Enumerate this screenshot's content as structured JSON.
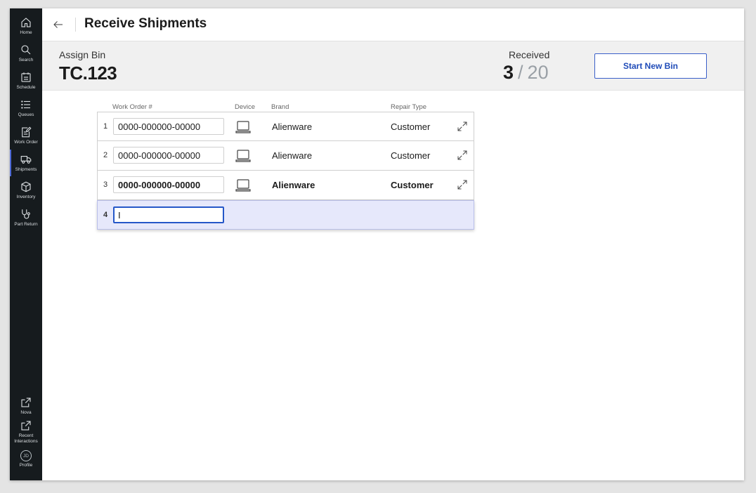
{
  "sidebar": {
    "items": [
      {
        "label": "Home",
        "icon": "home-icon"
      },
      {
        "label": "Search",
        "icon": "search-icon"
      },
      {
        "label": "Schedule",
        "icon": "calendar-icon"
      },
      {
        "label": "Queues",
        "icon": "list-icon"
      },
      {
        "label": "Work Order",
        "icon": "clipboard-edit-icon"
      },
      {
        "label": "Shipments",
        "icon": "truck-icon"
      },
      {
        "label": "Inventory",
        "icon": "box-icon"
      },
      {
        "label": "Part Return",
        "icon": "stethoscope-icon"
      }
    ],
    "bottom_items": [
      {
        "label": "Nova",
        "icon": "external-link-icon"
      },
      {
        "label": "Recent Interactions",
        "icon": "external-link-icon"
      },
      {
        "label": "Profile",
        "icon": "avatar",
        "initials": "JD"
      }
    ],
    "active": "Shipments",
    "accent_color": "#4f6bd8"
  },
  "header": {
    "title": "Receive Shipments"
  },
  "bin": {
    "label": "Assign Bin",
    "code": "TC.123"
  },
  "received": {
    "label": "Received",
    "count": "3",
    "separator": "/",
    "total": "20"
  },
  "actions": {
    "start_new_bin": "Start New Bin"
  },
  "table": {
    "columns": [
      "Work Order #",
      "Device",
      "Brand",
      "Repair Type"
    ],
    "rows": [
      {
        "index": "1",
        "work_order": "0000-000000-00000",
        "device": "laptop-icon",
        "brand": "Alienware",
        "repair_type": "Customer"
      },
      {
        "index": "2",
        "work_order": "0000-000000-00000",
        "device": "laptop-icon",
        "brand": "Alienware",
        "repair_type": "Customer"
      },
      {
        "index": "3",
        "work_order": "0000-000000-00000",
        "device": "laptop-icon",
        "brand": "Alienware",
        "repair_type": "Customer"
      },
      {
        "index": "4",
        "work_order": "I"
      }
    ]
  },
  "colors": {
    "sidebar_bg": "#161b1e",
    "primary": "#1f4bb8",
    "active_row_bg": "#e6e8fb"
  }
}
